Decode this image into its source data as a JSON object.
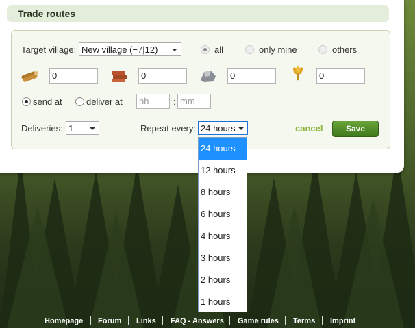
{
  "panel": {
    "title": "Trade routes"
  },
  "target": {
    "label": "Target village:",
    "selected": "New village (−7|12)",
    "filter_options": [
      {
        "label": "all",
        "checked": true
      },
      {
        "label": "only mine",
        "checked": false
      },
      {
        "label": "others",
        "checked": false
      }
    ]
  },
  "resources": [
    {
      "icon": "lumber-icon",
      "value": "0"
    },
    {
      "icon": "clay-icon",
      "value": "0"
    },
    {
      "icon": "iron-icon",
      "value": "0"
    },
    {
      "icon": "crop-icon",
      "value": "0"
    }
  ],
  "timing": {
    "send_at": "send at",
    "deliver_at": "deliver at",
    "send_checked": true,
    "hour_placeholder": "hh",
    "minute_placeholder": "mm",
    "separator": ":"
  },
  "deliveries": {
    "label": "Deliveries:",
    "value": "1"
  },
  "repeat": {
    "label": "Repeat every:",
    "value": "24 hours",
    "options": [
      "24 hours",
      "12 hours",
      "8 hours",
      "6 hours",
      "4 hours",
      "3 hours",
      "2 hours",
      "1 hours"
    ],
    "selected_index": 0
  },
  "actions": {
    "cancel": "cancel",
    "save": "Save"
  },
  "footer": [
    "Homepage",
    "Forum",
    "Links",
    "FAQ - Answers",
    "Game rules",
    "Terms",
    "Imprint"
  ],
  "colors": {
    "accent": "#8cb33a",
    "save": "#4f8c26",
    "highlight": "#1e90ff"
  }
}
